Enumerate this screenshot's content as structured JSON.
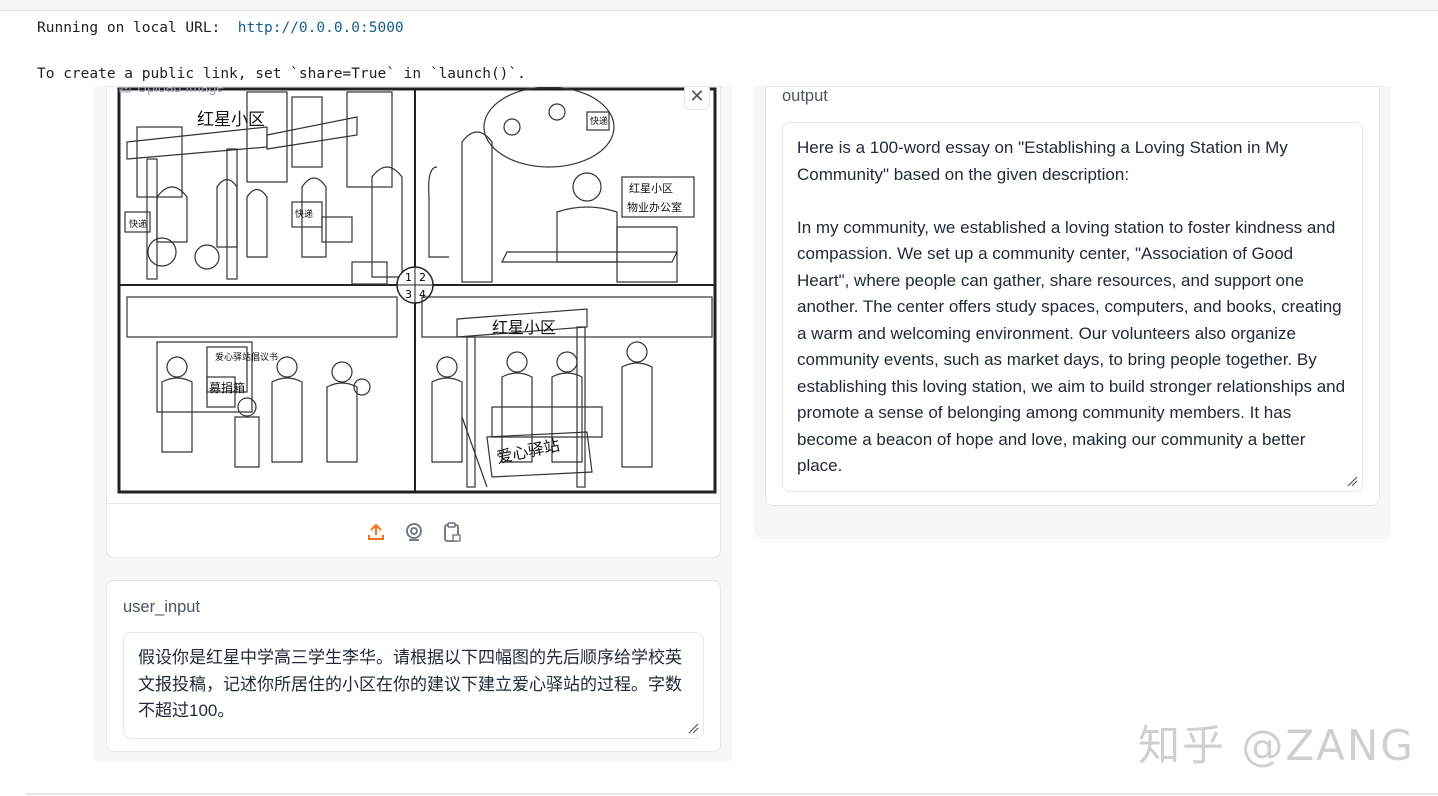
{
  "console": {
    "running_prefix": "Running on local URL:  ",
    "running_url": "http://0.0.0.0:5000",
    "public_link_note": "To create a public link, set `share=True` in `launch()`."
  },
  "image_input": {
    "label": "Upload Image",
    "close_icon": "close-icon",
    "toolbar_icons": [
      "upload-icon",
      "webcam-icon",
      "clipboard-icon"
    ],
    "comic_texts": {
      "gate_sign": "红星小区",
      "office_sign": "红星小区\n物业办公室",
      "proposal_board": "爱心驿站倡议书",
      "donation_box": "募捐箱",
      "gate_sign_2": "红星小区",
      "station_sign": "爱心驿站",
      "panel_numbers": [
        "1",
        "2",
        "3",
        "4"
      ],
      "parcel_labels": [
        "快递",
        "快递",
        "快递"
      ]
    }
  },
  "user_input": {
    "label": "user_input",
    "value": "假设你是红星中学高三学生李华。请根据以下四幅图的先后顺序给学校英文报投稿，记述你所居住的小区在你的建议下建立爱心驿站的过程。字数不超过100。"
  },
  "output": {
    "label": "output",
    "value": "Here is a 100-word essay on \"Establishing a Loving Station in My Community\" based on the given description:\n\nIn my community, we established a loving station to foster kindness and compassion. We set up a community center, \"Association of Good Heart\", where people can gather, share resources, and support one another. The center offers study spaces, computers, and books, creating a warm and welcoming environment. Our volunteers also organize community events, such as market days, to bring people together. By establishing this loving station, we aim to build stronger relationships and promote a sense of belonging among community members. It has become a beacon of hope and love, making our community a better place."
  },
  "watermark": "知乎 @ZANG",
  "colors": {
    "accent": "#f97316",
    "panel_bg": "#f7f7f8",
    "border": "#e5e7eb"
  }
}
